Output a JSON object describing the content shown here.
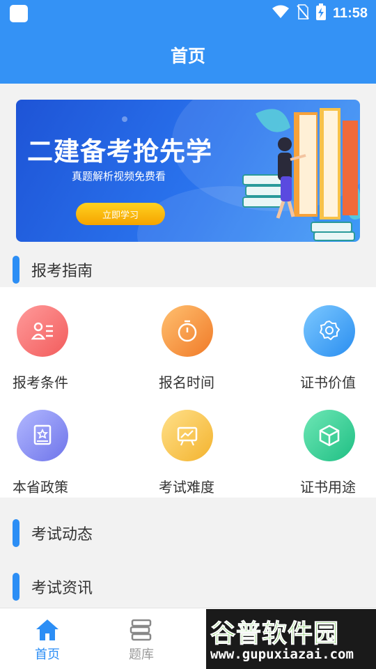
{
  "status_bar": {
    "time": "11:58"
  },
  "header": {
    "title": "首页"
  },
  "banner": {
    "headline": "二建备考抢先学",
    "subline": "真题解析视频免费看",
    "cta_label": "立即学习"
  },
  "sections": {
    "guide": "报考指南",
    "dynamics": "考试动态",
    "news": "考试资讯"
  },
  "guide_items": [
    {
      "label": "报考条件",
      "icon": "person-card-icon",
      "color": "#f76b6b"
    },
    {
      "label": "报名时间",
      "icon": "stopwatch-icon",
      "color": "#f59a3a"
    },
    {
      "label": "证书价值",
      "icon": "badge-icon",
      "color": "#3aa4f7"
    },
    {
      "label": "本省政策",
      "icon": "policy-book-icon",
      "color": "#8a8ff3"
    },
    {
      "label": "考试难度",
      "icon": "chart-board-icon",
      "color": "#f7c24a"
    },
    {
      "label": "证书用途",
      "icon": "cube-icon",
      "color": "#2fd19a"
    }
  ],
  "tabbar": {
    "items": [
      {
        "label": "首页",
        "icon": "home-icon",
        "active": true
      },
      {
        "label": "题库",
        "icon": "books-icon",
        "active": false
      }
    ],
    "active_color": "#2c8ef5",
    "inactive_color": "#999999"
  },
  "watermark": {
    "title": "谷普软件园",
    "url": "www.gupuxiazai.com"
  }
}
